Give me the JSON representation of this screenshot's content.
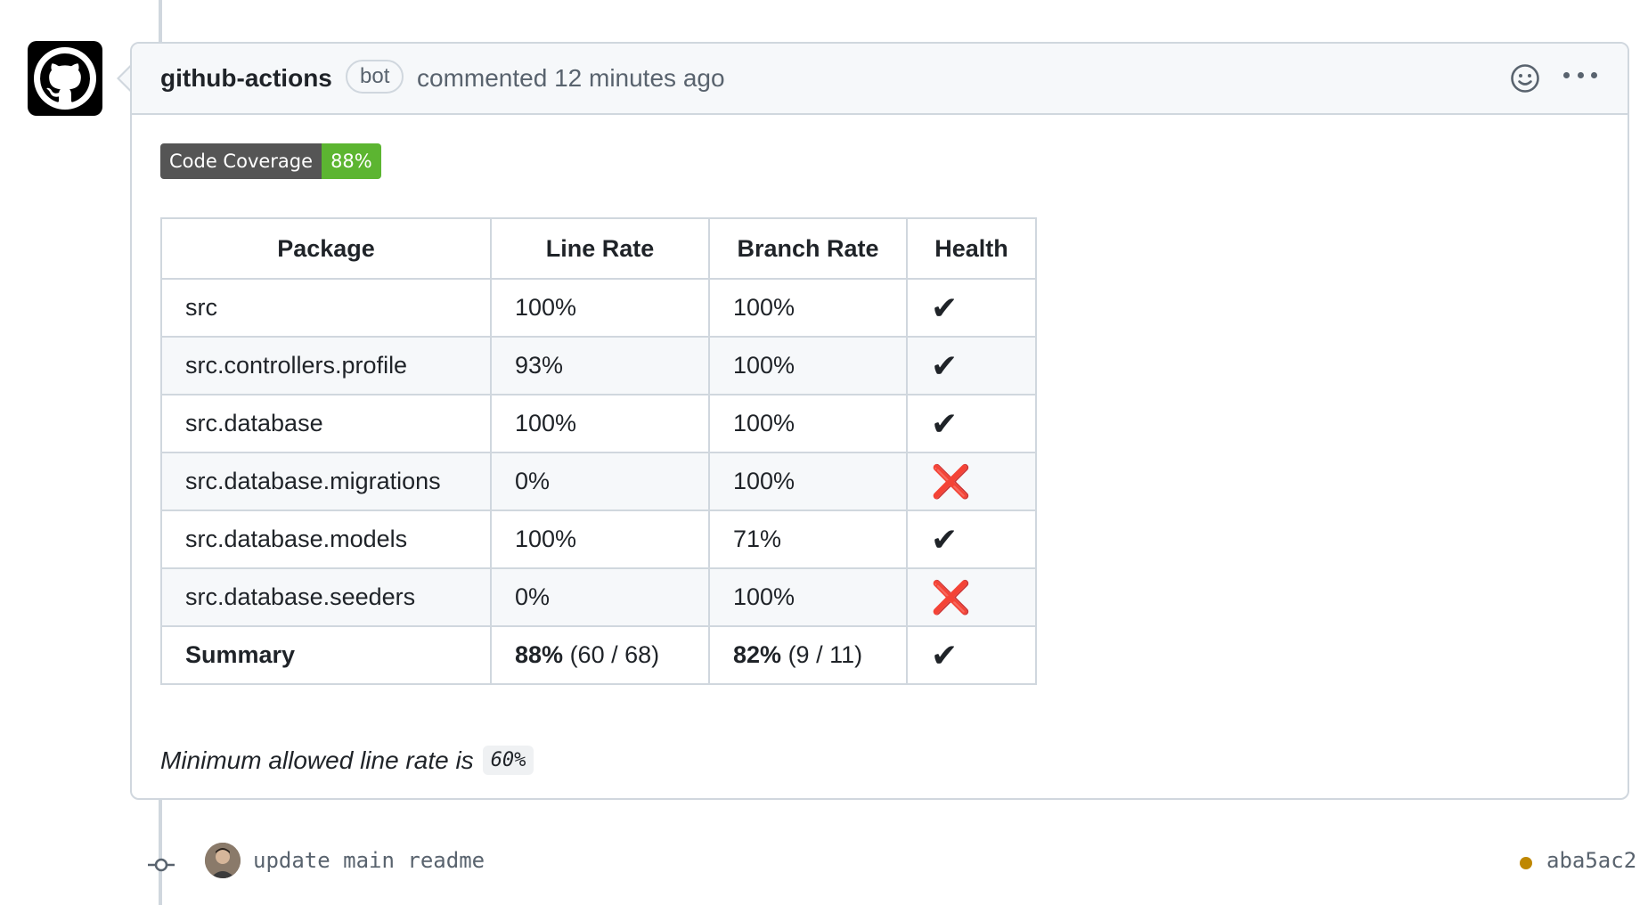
{
  "comment": {
    "author": "github-actions",
    "badge": "bot",
    "meta": "commented 12 minutes ago",
    "icons": [
      "smiley-icon",
      "kebab-horizontal-icon"
    ]
  },
  "coverage_badge": {
    "label": "Code Coverage",
    "value": "88%",
    "label_color": "#555555",
    "value_color": "#5cb531"
  },
  "table": {
    "headers": [
      "Package",
      "Line Rate",
      "Branch Rate",
      "Health"
    ],
    "rows": [
      {
        "package": "src",
        "line": "100%",
        "branch": "100%",
        "health": "✔"
      },
      {
        "package": "src.controllers.profile",
        "line": "93%",
        "branch": "100%",
        "health": "✔"
      },
      {
        "package": "src.database",
        "line": "100%",
        "branch": "100%",
        "health": "✔"
      },
      {
        "package": "src.database.migrations",
        "line": "0%",
        "branch": "100%",
        "health": "❌"
      },
      {
        "package": "src.database.models",
        "line": "100%",
        "branch": "71%",
        "health": "✔"
      },
      {
        "package": "src.database.seeders",
        "line": "0%",
        "branch": "100%",
        "health": "❌"
      }
    ],
    "summary": {
      "label": "Summary",
      "line_pct": "88%",
      "line_detail": "(60 / 68)",
      "branch_pct": "82%",
      "branch_detail": "(9 / 11)",
      "health": "✔"
    }
  },
  "note": {
    "text": "Minimum allowed line rate is",
    "value": "60%"
  },
  "commit": {
    "message": "update main readme",
    "sha": "aba5ac2",
    "status_color": "#bf8700"
  }
}
